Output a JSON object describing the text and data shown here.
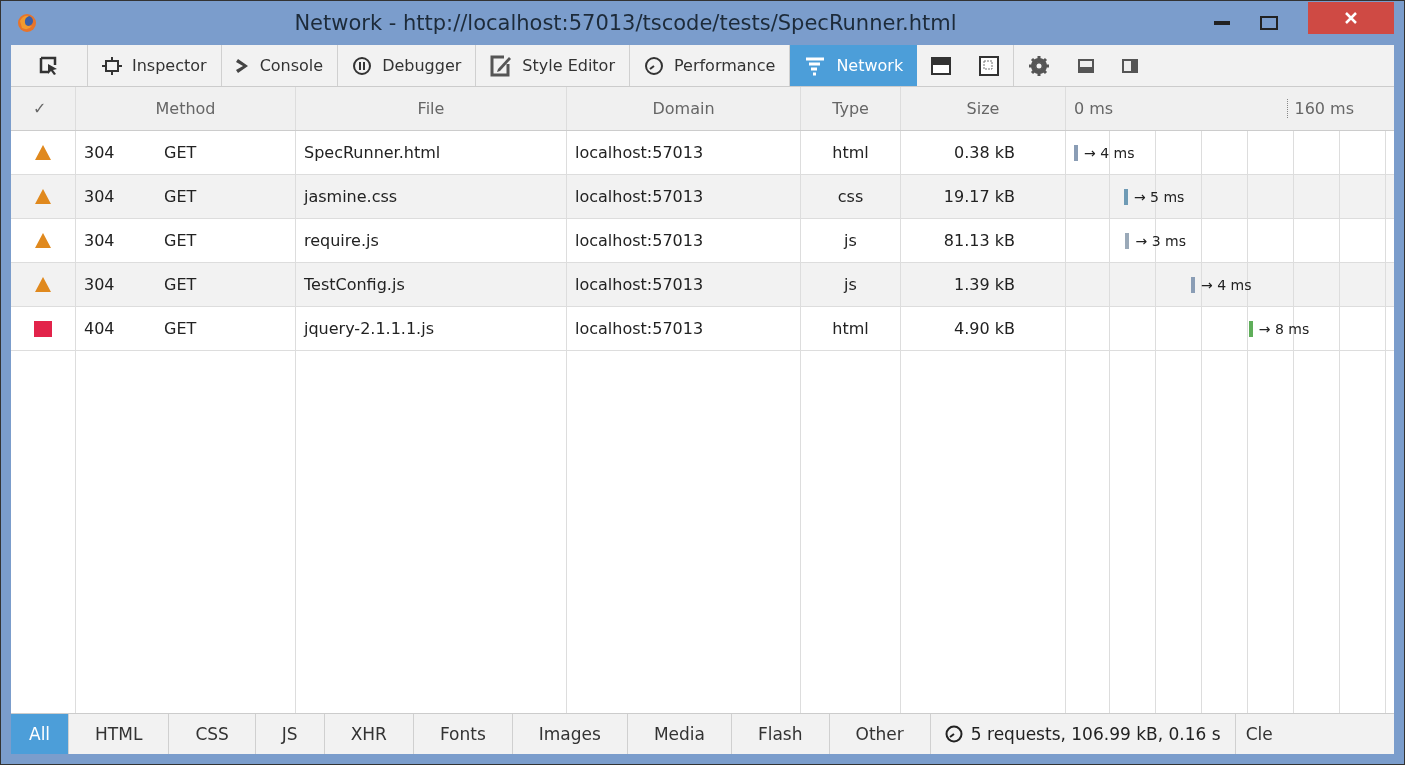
{
  "window": {
    "title": "Network - http://localhost:57013/tscode/tests/SpecRunner.html"
  },
  "toolbar": {
    "tabs": [
      {
        "label": "Inspector",
        "selected": false
      },
      {
        "label": "Console",
        "selected": false
      },
      {
        "label": "Debugger",
        "selected": false
      },
      {
        "label": "Style Editor",
        "selected": false
      },
      {
        "label": "Performance",
        "selected": false
      },
      {
        "label": "Network",
        "selected": true
      }
    ]
  },
  "table": {
    "columns": [
      "✓",
      "Method",
      "File",
      "Domain",
      "Type",
      "Size"
    ],
    "timeline_ticks": [
      "0 ms",
      "160 ms"
    ],
    "rows": [
      {
        "kind": "warning",
        "status": "304",
        "method": "GET",
        "file": "SpecRunner.html",
        "domain": "localhost:57013",
        "type": "html",
        "size": "0.38 kB",
        "level": 0.0,
        "color": "#8a9db5",
        "timing": "→ 4 ms"
      },
      {
        "kind": "warning",
        "status": "304",
        "method": "GET",
        "file": "jasmine.css",
        "domain": "localhost:57013",
        "type": "css",
        "size": "19.17 kB",
        "level": 0.16,
        "color": "#6f9bb5",
        "timing": "→ 5 ms"
      },
      {
        "kind": "warning",
        "status": "304",
        "method": "GET",
        "file": "require.js",
        "domain": "localhost:57013",
        "type": "js",
        "size": "81.13 kB",
        "level": 0.165,
        "color": "#9aa9b8",
        "timing": "→ 3 ms"
      },
      {
        "kind": "warning",
        "status": "304",
        "method": "GET",
        "file": "TestConfig.js",
        "domain": "localhost:57013",
        "type": "js",
        "size": "1.39 kB",
        "level": 0.375,
        "color": "#8a9db5",
        "timing": "→ 4 ms"
      },
      {
        "kind": "error",
        "status": "404",
        "method": "GET",
        "file": "jquery-2.1.1.1.js",
        "domain": "localhost:57013",
        "type": "html",
        "size": "4.90 kB",
        "level": 0.56,
        "color": "#5fae5a",
        "timing": "→ 8 ms"
      }
    ]
  },
  "filters": [
    {
      "label": "All",
      "selected": true
    },
    {
      "label": "HTML",
      "selected": false
    },
    {
      "label": "CSS",
      "selected": false
    },
    {
      "label": "JS",
      "selected": false
    },
    {
      "label": "XHR",
      "selected": false
    },
    {
      "label": "Fonts",
      "selected": false
    },
    {
      "label": "Images",
      "selected": false
    },
    {
      "label": "Media",
      "selected": false
    },
    {
      "label": "Flash",
      "selected": false
    },
    {
      "label": "Other",
      "selected": false
    }
  ],
  "status_bar": {
    "summary": "5 requests, 106.99 kB, 0.16 s",
    "clear_button": "Cle"
  }
}
